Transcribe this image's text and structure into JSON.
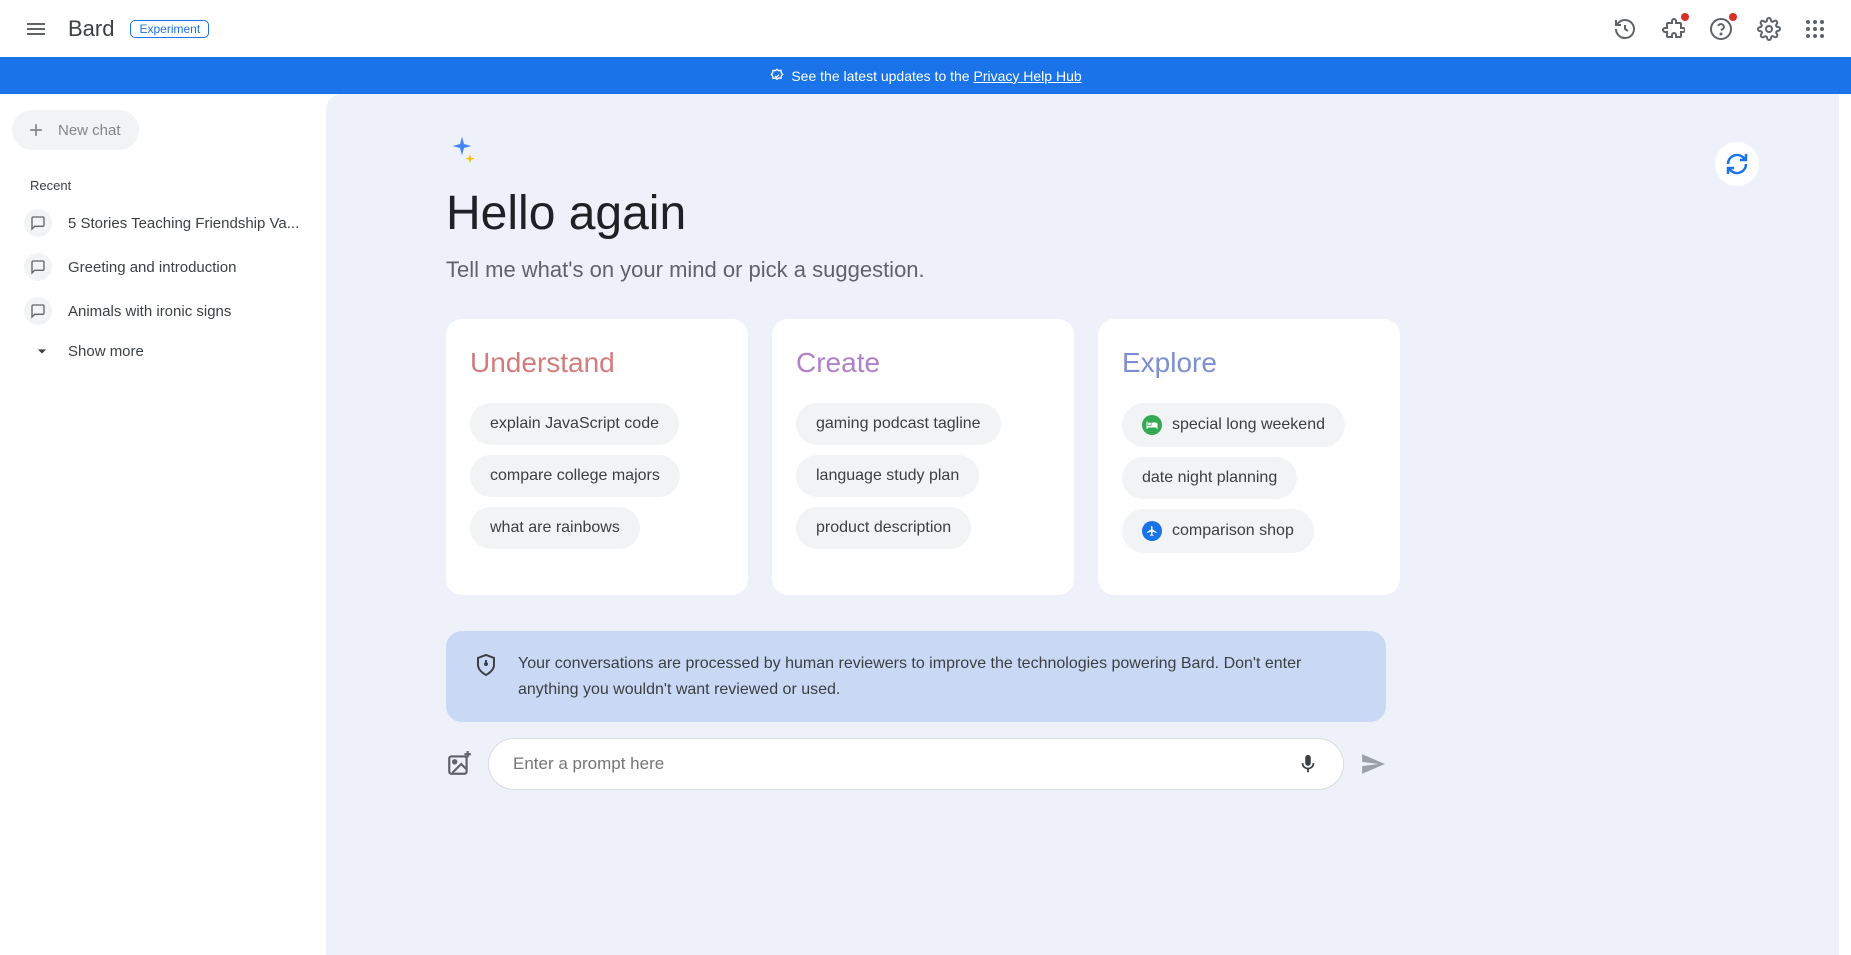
{
  "header": {
    "logo": "Bard",
    "badge": "Experiment"
  },
  "banner": {
    "text_prefix": "See the latest updates to the ",
    "link_text": "Privacy Help Hub"
  },
  "sidebar": {
    "newchat": "New chat",
    "recent_label": "Recent",
    "items": [
      "5 Stories Teaching Friendship Va...",
      "Greeting and introduction",
      "Animals with ironic signs"
    ],
    "showmore": "Show more"
  },
  "main": {
    "greeting": "Hello again",
    "subtitle": "Tell me what's on your mind or pick a suggestion.",
    "cards": [
      {
        "title": "Understand",
        "theme": "t-understand",
        "pills": [
          {
            "label": "explain JavaScript code",
            "icon": null
          },
          {
            "label": "compare college majors",
            "icon": null
          },
          {
            "label": "what are rainbows",
            "icon": null
          }
        ]
      },
      {
        "title": "Create",
        "theme": "t-create",
        "pills": [
          {
            "label": "gaming podcast tagline",
            "icon": null
          },
          {
            "label": "language study plan",
            "icon": null
          },
          {
            "label": "product description",
            "icon": null
          }
        ]
      },
      {
        "title": "Explore",
        "theme": "t-explore",
        "pills": [
          {
            "label": "special long weekend",
            "icon": "hotel"
          },
          {
            "label": "date night planning",
            "icon": null
          },
          {
            "label": "comparison shop",
            "icon": "flight"
          }
        ]
      }
    ],
    "notice": "Your conversations are processed by human reviewers to improve the technologies powering Bard. Don't enter anything you wouldn't want reviewed or used.",
    "input_placeholder": "Enter a prompt here"
  }
}
